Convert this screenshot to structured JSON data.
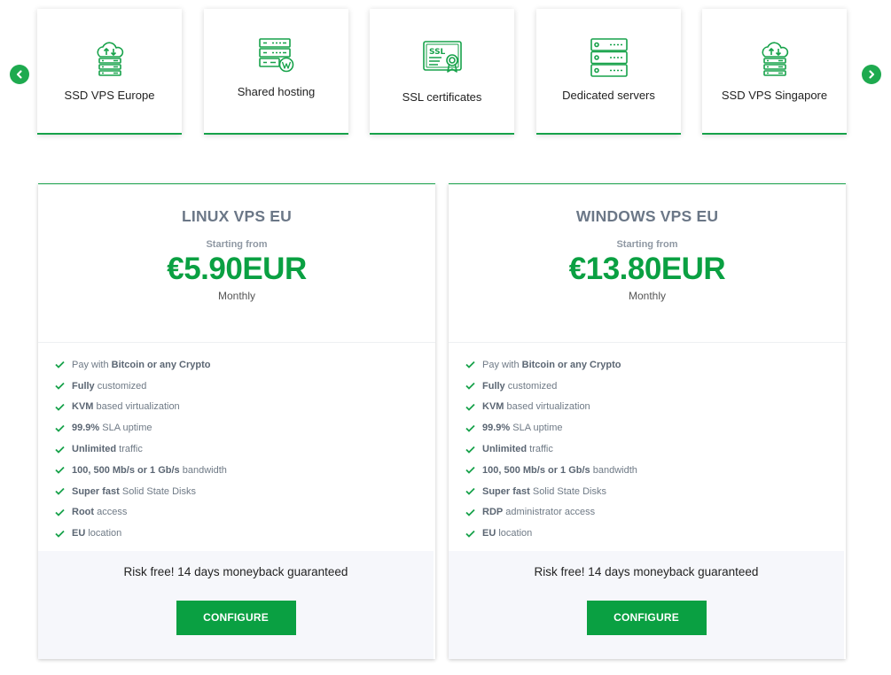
{
  "colors": {
    "accent": "#0aa042",
    "heading": "#6b7787",
    "panel": "#f6f7fb"
  },
  "carousel": {
    "prev_icon": "chevron-left-icon",
    "next_icon": "chevron-right-icon",
    "items": [
      {
        "label": "SSD VPS Europe",
        "icon": "cloud-server-icon"
      },
      {
        "label": "Shared hosting",
        "icon": "wordpress-server-icon"
      },
      {
        "label": "SSL certificates",
        "icon": "ssl-certificate-icon"
      },
      {
        "label": "Dedicated servers",
        "icon": "server-rack-icon"
      },
      {
        "label": "SSD VPS Singapore",
        "icon": "cloud-server-icon"
      }
    ]
  },
  "plans": [
    {
      "title": "LINUX VPS EU",
      "starting": "Starting from",
      "price": "€5.90EUR",
      "period": "Monthly",
      "features": [
        {
          "pre": "Pay with ",
          "bold": "Bitcoin or any Crypto",
          "post": ""
        },
        {
          "pre": "",
          "bold": "Fully",
          "post": " customized"
        },
        {
          "pre": "",
          "bold": "KVM",
          "post": " based virtualization"
        },
        {
          "pre": "",
          "bold": "99.9%",
          "post": " SLA uptime"
        },
        {
          "pre": "",
          "bold": "Unlimited",
          "post": " traffic"
        },
        {
          "pre": "",
          "bold": "100, 500 Mb/s or 1 Gb/s",
          "post": " bandwidth"
        },
        {
          "pre": "",
          "bold": "Super fast",
          "post": " Solid State Disks"
        },
        {
          "pre": "",
          "bold": "Root",
          "post": " access"
        },
        {
          "pre": "",
          "bold": "EU",
          "post": " location"
        }
      ],
      "guarantee": "Risk free! 14 days moneyback guaranteed",
      "button": "CONFIGURE"
    },
    {
      "title": "WINDOWS VPS EU",
      "starting": "Starting from",
      "price": "€13.80EUR",
      "period": "Monthly",
      "features": [
        {
          "pre": "Pay with ",
          "bold": "Bitcoin or any Crypto",
          "post": ""
        },
        {
          "pre": "",
          "bold": "Fully",
          "post": " customized"
        },
        {
          "pre": "",
          "bold": "KVM",
          "post": " based virtualization"
        },
        {
          "pre": "",
          "bold": "99.9%",
          "post": " SLA uptime"
        },
        {
          "pre": "",
          "bold": "Unlimited",
          "post": " traffic"
        },
        {
          "pre": "",
          "bold": "100, 500 Mb/s or 1 Gb/s",
          "post": " bandwidth"
        },
        {
          "pre": "",
          "bold": "Super fast",
          "post": " Solid State Disks"
        },
        {
          "pre": "",
          "bold": "RDP",
          "post": " administrator access"
        },
        {
          "pre": "",
          "bold": "EU",
          "post": " location"
        }
      ],
      "guarantee": "Risk free! 14 days moneyback guaranteed",
      "button": "CONFIGURE"
    }
  ]
}
